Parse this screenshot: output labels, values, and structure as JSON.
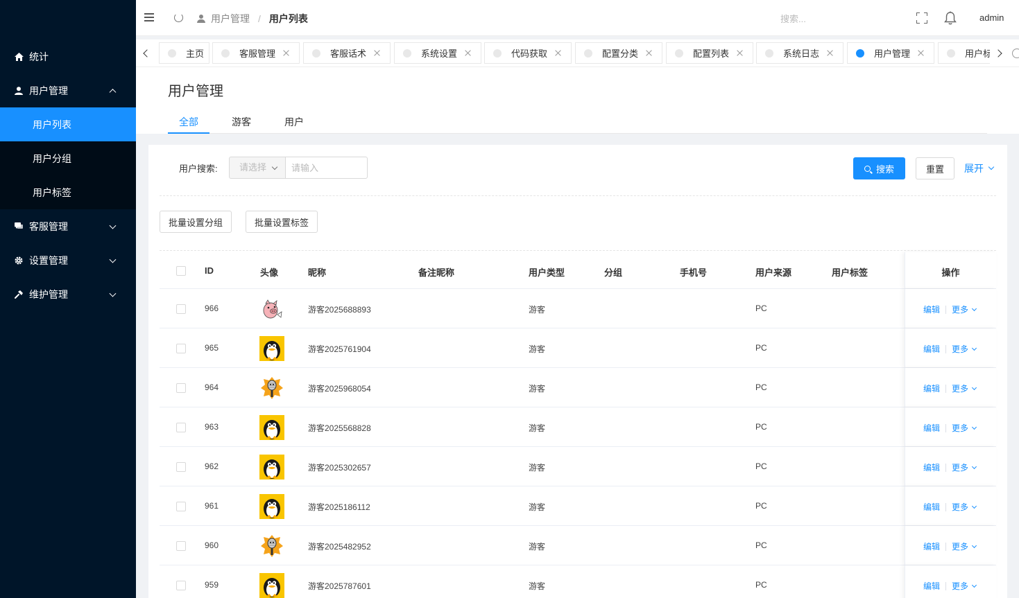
{
  "sidebar": {
    "items": [
      {
        "label": "统计",
        "icon": "home-icon"
      },
      {
        "label": "用户管理",
        "icon": "user-icon",
        "expanded": true,
        "children": [
          {
            "label": "用户列表",
            "active": true
          },
          {
            "label": "用户分组"
          },
          {
            "label": "用户标签"
          }
        ]
      },
      {
        "label": "客服管理",
        "icon": "chat-icon"
      },
      {
        "label": "设置管理",
        "icon": "gear-icon"
      },
      {
        "label": "维护管理",
        "icon": "wrench-icon"
      }
    ]
  },
  "header": {
    "breadcrumb_parent": "用户管理",
    "breadcrumb_separator": "/",
    "breadcrumb_current": "用户列表",
    "search_placeholder": "搜索...",
    "username": "admin"
  },
  "tabs": [
    {
      "label": "主页",
      "closable": false
    },
    {
      "label": "客服管理",
      "closable": true
    },
    {
      "label": "客服话术",
      "closable": true
    },
    {
      "label": "系统设置",
      "closable": true
    },
    {
      "label": "代码获取",
      "closable": true
    },
    {
      "label": "配置分类",
      "closable": true
    },
    {
      "label": "配置列表",
      "closable": true
    },
    {
      "label": "系统日志",
      "closable": true
    },
    {
      "label": "用户管理",
      "closable": true,
      "active": true
    },
    {
      "label": "用户标",
      "closable": false
    }
  ],
  "page": {
    "title": "用户管理",
    "subtabs": [
      "全部",
      "游客",
      "用户"
    ],
    "active_subtab": 0
  },
  "filter": {
    "label": "用户搜索:",
    "select_placeholder": "请选择",
    "input_placeholder": "请输入",
    "search_button": "搜索",
    "reset_button": "重置",
    "expand_link": "展开"
  },
  "batch": {
    "group_button": "批量设置分组",
    "tag_button": "批量设置标签"
  },
  "table": {
    "columns": [
      "ID",
      "头像",
      "昵称",
      "备注昵称",
      "用户类型",
      "分组",
      "手机号",
      "用户来源",
      "用户标签",
      "操作"
    ],
    "actions": {
      "edit": "编辑",
      "more": "更多"
    },
    "rows": [
      {
        "id": "966",
        "avatar": "pig",
        "nickname": "游客2025688893",
        "remark": "",
        "type": "游客",
        "group": "",
        "phone": "",
        "source": "PC",
        "tags": ""
      },
      {
        "id": "965",
        "avatar": "penguin",
        "nickname": "游客2025761904",
        "remark": "",
        "type": "游客",
        "group": "",
        "phone": "",
        "source": "PC",
        "tags": ""
      },
      {
        "id": "964",
        "avatar": "microphone",
        "nickname": "游客2025968054",
        "remark": "",
        "type": "游客",
        "group": "",
        "phone": "",
        "source": "PC",
        "tags": ""
      },
      {
        "id": "963",
        "avatar": "penguin",
        "nickname": "游客2025568828",
        "remark": "",
        "type": "游客",
        "group": "",
        "phone": "",
        "source": "PC",
        "tags": ""
      },
      {
        "id": "962",
        "avatar": "penguin",
        "nickname": "游客2025302657",
        "remark": "",
        "type": "游客",
        "group": "",
        "phone": "",
        "source": "PC",
        "tags": ""
      },
      {
        "id": "961",
        "avatar": "penguin",
        "nickname": "游客2025186112",
        "remark": "",
        "type": "游客",
        "group": "",
        "phone": "",
        "source": "PC",
        "tags": ""
      },
      {
        "id": "960",
        "avatar": "microphone",
        "nickname": "游客2025482952",
        "remark": "",
        "type": "游客",
        "group": "",
        "phone": "",
        "source": "PC",
        "tags": ""
      },
      {
        "id": "959",
        "avatar": "penguin",
        "nickname": "游客2025787601",
        "remark": "",
        "type": "游客",
        "group": "",
        "phone": "",
        "source": "PC",
        "tags": ""
      }
    ]
  },
  "colors": {
    "sidebar_bg": "#001529",
    "submenu_bg": "#000c17",
    "accent": "#1890ff"
  }
}
